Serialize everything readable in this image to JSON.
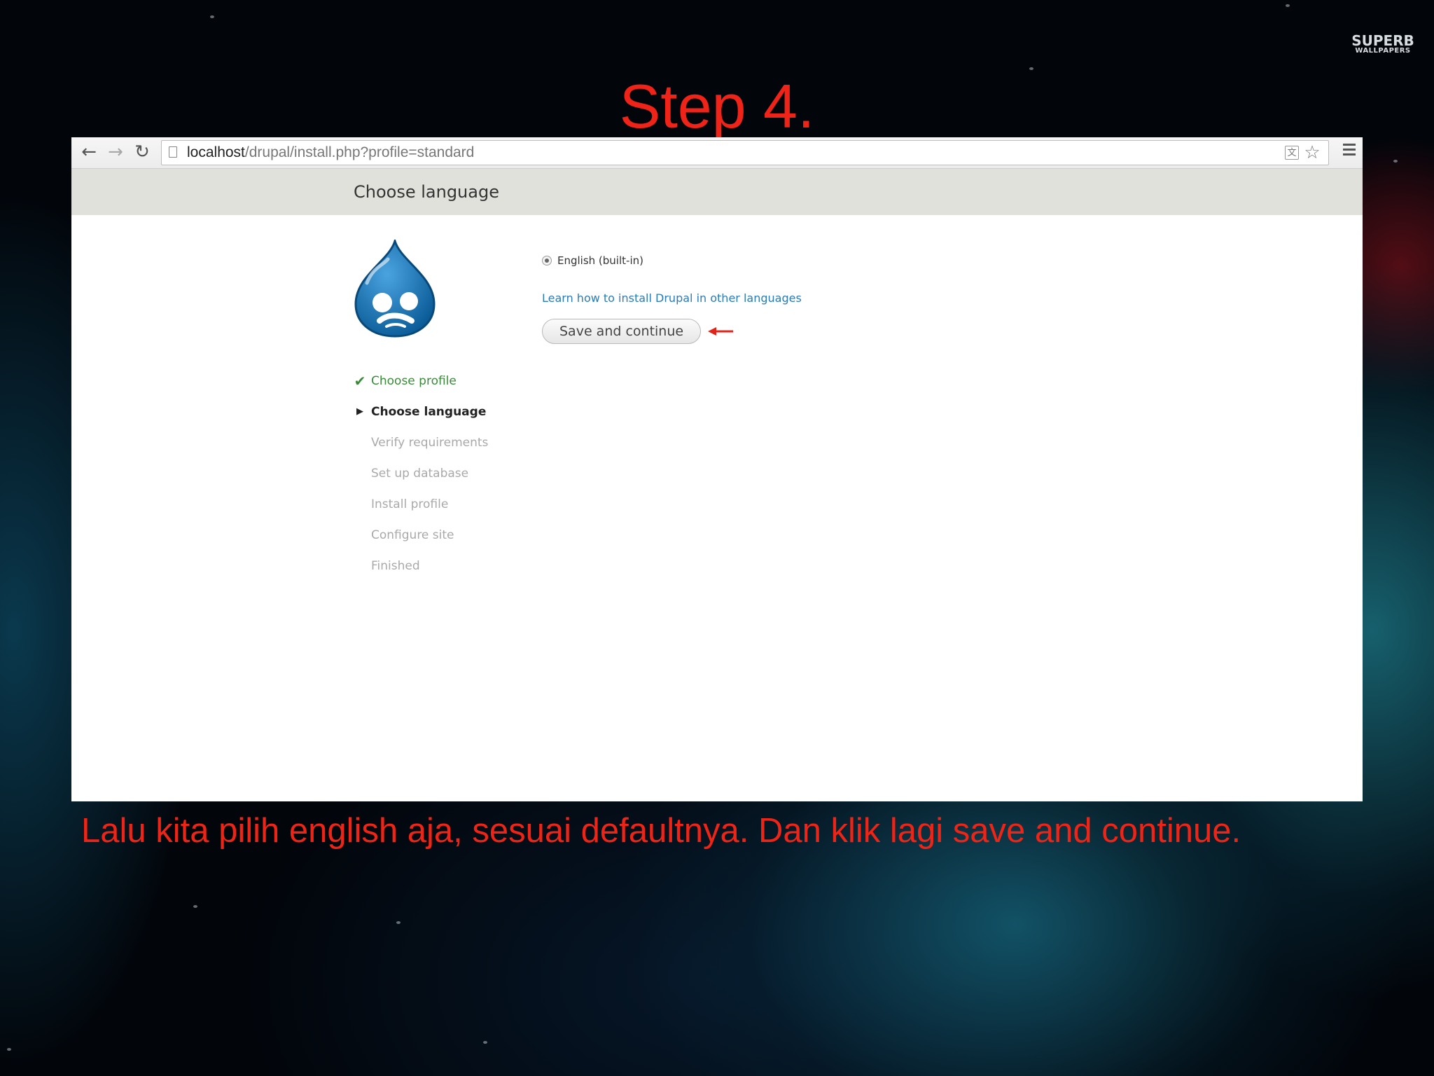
{
  "overlay": {
    "step_title": "Step 4.",
    "caption": "Lalu kita pilih english aja, sesuai defaultnya. Dan klik lagi save and continue.",
    "watermark_top": "SUPERB",
    "watermark_bottom": "WALLPAPERS",
    "colors": {
      "text_red": "#ef2318"
    }
  },
  "browser": {
    "url_host": "localhost",
    "url_path": "/drupal/install.php?profile=standard",
    "icons": [
      "back-arrow-icon",
      "forward-arrow-icon",
      "reload-icon",
      "page-icon",
      "translate-icon",
      "bookmark-star-icon",
      "menu-icon"
    ]
  },
  "page": {
    "title": "Choose language",
    "logo": "drupal-drop-logo",
    "steps": [
      {
        "label": "Choose profile",
        "state": "done"
      },
      {
        "label": "Choose language",
        "state": "active"
      },
      {
        "label": "Verify requirements",
        "state": "pending"
      },
      {
        "label": "Set up database",
        "state": "pending"
      },
      {
        "label": "Install profile",
        "state": "pending"
      },
      {
        "label": "Configure site",
        "state": "pending"
      },
      {
        "label": "Finished",
        "state": "pending"
      }
    ],
    "language_option": {
      "label": "English (built-in)",
      "selected": true
    },
    "help_link": "Learn how to install Drupal in other languages",
    "save_button": "Save and continue",
    "colors": {
      "link": "#2b7bb9",
      "done": "#3b8a3b",
      "header_bg": "#e1e1dc"
    }
  }
}
